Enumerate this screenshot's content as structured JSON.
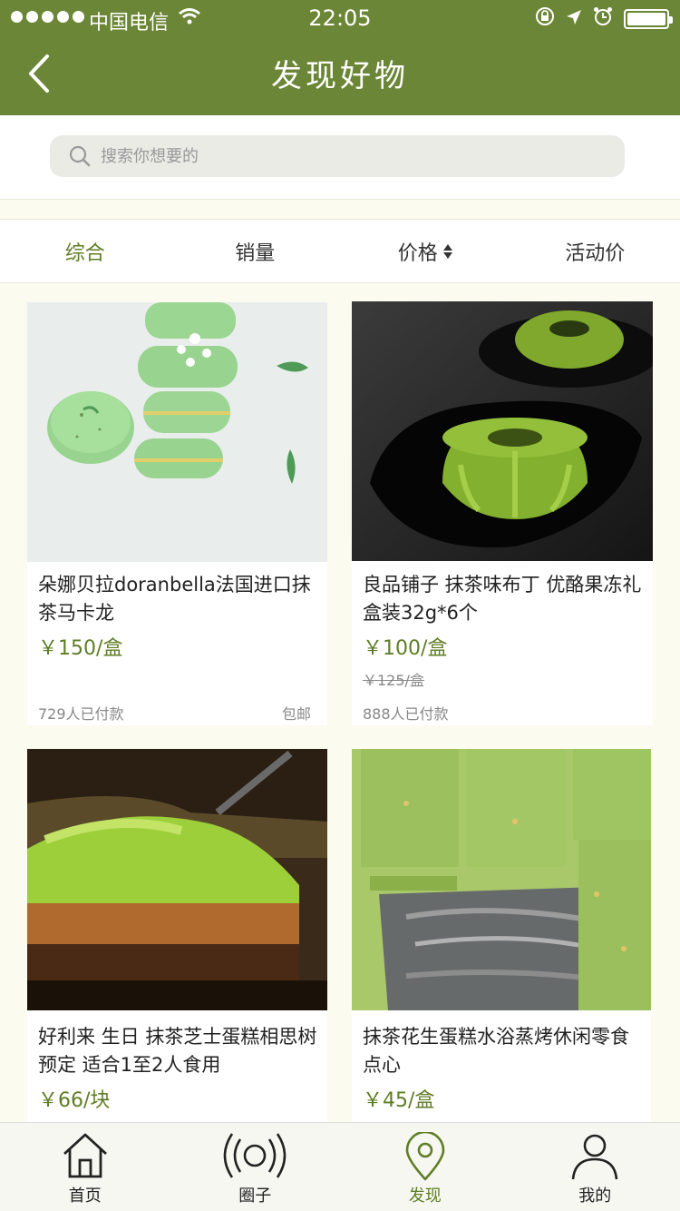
{
  "status_bar": {
    "carrier": "中国电信",
    "time": "22:05"
  },
  "header": {
    "title": "发现好物"
  },
  "search": {
    "placeholder": "搜索你想要的"
  },
  "sort_tabs": [
    {
      "label": "综合",
      "active": true
    },
    {
      "label": "销量"
    },
    {
      "label": "价格"
    },
    {
      "label": "活动价"
    }
  ],
  "products": [
    {
      "title": "朵娜贝拉doranbella法国进口抹茶马卡龙",
      "price": "￥150/盒",
      "paid": "729人已付款",
      "shipping": "包邮"
    },
    {
      "title": "良品铺子 抹茶味布丁 优酪果冻礼盒装32g*6个",
      "price": "￥100/盒",
      "old_price": "￥125/盒",
      "paid": "888人已付款"
    },
    {
      "title": "好利来 生日 抹茶芝士蛋糕相思树 预定 适合1至2人食用",
      "price": "￥66/块"
    },
    {
      "title": "抹茶花生蛋糕水浴蒸烤休闲零食点心",
      "price": "￥45/盒"
    }
  ],
  "tabbar": [
    {
      "label": "首页",
      "icon": "home-icon"
    },
    {
      "label": "圈子",
      "icon": "broadcast-icon"
    },
    {
      "label": "发现",
      "icon": "location-pin-icon",
      "active": true
    },
    {
      "label": "我的",
      "icon": "user-icon"
    }
  ],
  "colors": {
    "brand": "#6b8636",
    "accent": "#5f7d26",
    "background": "#fbfbef"
  }
}
